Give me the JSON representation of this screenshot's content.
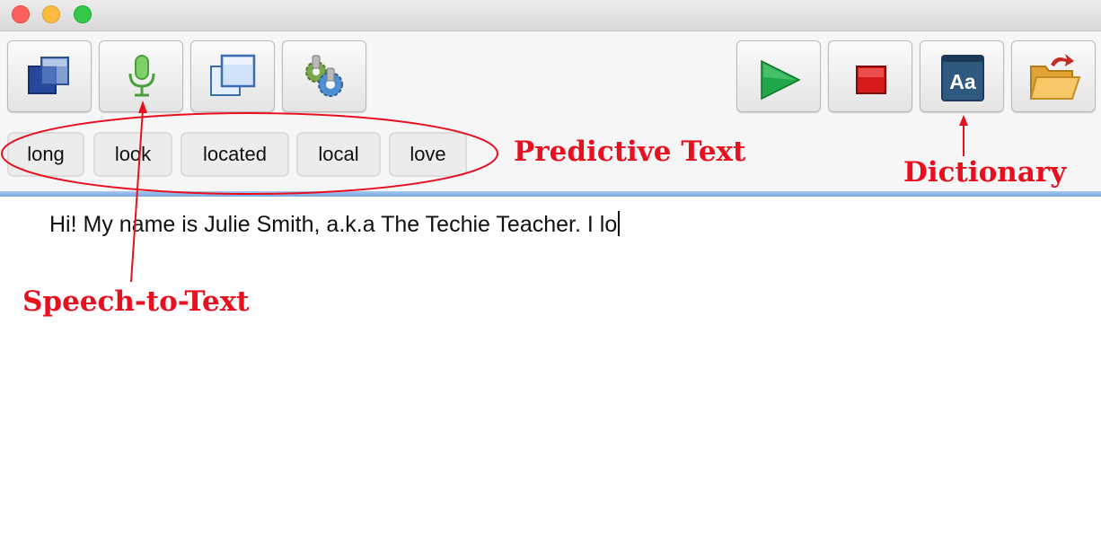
{
  "window": {
    "controls": [
      "close-button",
      "minimize-button",
      "zoom-button"
    ]
  },
  "toolbar": {
    "left_buttons": [
      {
        "name": "windows-overlay-icon"
      },
      {
        "name": "microphone-icon"
      },
      {
        "name": "window-icon"
      },
      {
        "name": "gears-icon"
      }
    ],
    "right_buttons": [
      {
        "name": "play-icon"
      },
      {
        "name": "stop-icon"
      },
      {
        "name": "dictionary-icon",
        "label": "Aa"
      },
      {
        "name": "open-folder-icon"
      }
    ]
  },
  "predictions": [
    "long",
    "look",
    "located",
    "local",
    "love"
  ],
  "document": {
    "text": "Hi! My name is Julie Smith, a.k.a The Techie Teacher. I lo"
  },
  "annotations": {
    "predictive_text": "Predictive Text",
    "dictionary": "Dictionary",
    "speech_to_text": "Speech-to-Text",
    "color": "#e8101f"
  }
}
